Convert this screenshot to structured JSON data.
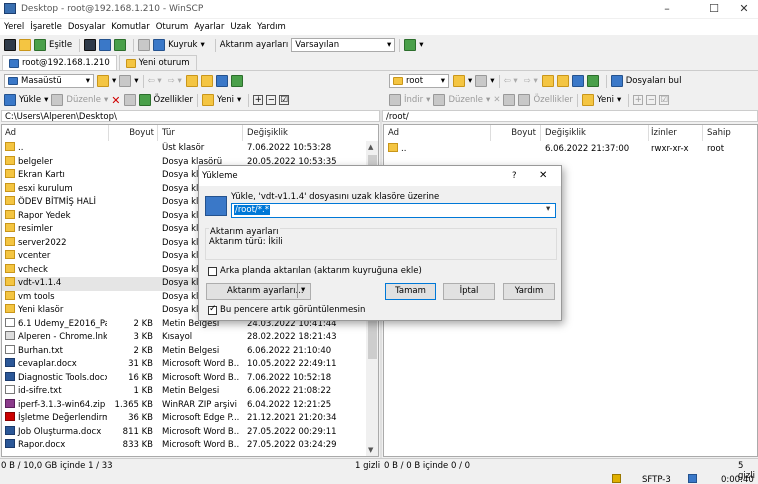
{
  "window": {
    "title": "Desktop - root@192.168.1.210 - WinSCP",
    "minimize": "–",
    "maximize": "☐",
    "close": "✕"
  },
  "menu": [
    "Yerel",
    "İşaretle",
    "Dosyalar",
    "Komutlar",
    "Oturum",
    "Ayarlar",
    "Uzak",
    "Yardım"
  ],
  "toolbar": {
    "sync_label": "Eşitle",
    "queue_label": "Kuyruk",
    "transfer_label": "Aktarım ayarları",
    "transfer_value": "Varsayılan"
  },
  "tabs": {
    "session": "root@192.168.1.210",
    "new_session": "Yeni oturum"
  },
  "left": {
    "location": "Masaüstü",
    "actions": {
      "upload": "Yükle",
      "edit": "Düzenle",
      "properties": "Özellikler",
      "new": "Yeni"
    },
    "path": "C:\\Users\\Alperen\\Desktop\\",
    "columns": {
      "name": "Ad",
      "size": "Boyut",
      "type": "Tür",
      "changed": "Değişiklik"
    },
    "rows": [
      {
        "icon": "up",
        "name": "..",
        "size": "",
        "type": "Üst klasör",
        "changed": "7.06.2022  10:53:28"
      },
      {
        "icon": "folder",
        "name": "belgeler",
        "size": "",
        "type": "Dosya klasörü",
        "changed": "20.05.2022  10:53:35"
      },
      {
        "icon": "folder",
        "name": "Ekran Kartı",
        "size": "",
        "type": "Dosya klas",
        "changed": ""
      },
      {
        "icon": "folder",
        "name": "esxi kurulum",
        "size": "",
        "type": "Dosya klas",
        "changed": ""
      },
      {
        "icon": "folder",
        "name": "ÖDEV BİTMİŞ HALİ",
        "size": "",
        "type": "Dosya klas",
        "changed": ""
      },
      {
        "icon": "folder",
        "name": "Rapor Yedek",
        "size": "",
        "type": "Dosya klas",
        "changed": ""
      },
      {
        "icon": "folder",
        "name": "resimler",
        "size": "",
        "type": "Dosya klas",
        "changed": ""
      },
      {
        "icon": "folder",
        "name": "server2022",
        "size": "",
        "type": "Dosya klas",
        "changed": ""
      },
      {
        "icon": "folder",
        "name": "vcenter",
        "size": "",
        "type": "Dosya klas",
        "changed": ""
      },
      {
        "icon": "folder",
        "name": "vcheck",
        "size": "",
        "type": "Dosya klas",
        "changed": ""
      },
      {
        "icon": "folder",
        "name": "vdt-v1.1.4",
        "size": "",
        "type": "Dosya klas",
        "changed": "",
        "selected": true
      },
      {
        "icon": "folder",
        "name": "vm tools",
        "size": "",
        "type": "Dosya klas",
        "changed": ""
      },
      {
        "icon": "folder",
        "name": "Yeni klasör",
        "size": "",
        "type": "Dosya klas",
        "changed": ""
      },
      {
        "icon": "doc",
        "name": "6.1 Udemy_E2016_Par...",
        "size": "2 KB",
        "type": "Metin Belgesi",
        "changed": "24.03.2022  10:41:44"
      },
      {
        "icon": "lnk",
        "name": "Alperen - Chrome.lnk",
        "size": "3 KB",
        "type": "Kısayol",
        "changed": "28.02.2022  18:21:43"
      },
      {
        "icon": "doc",
        "name": "Burhan.txt",
        "size": "2 KB",
        "type": "Metin Belgesi",
        "changed": "6.06.2022  21:10:40"
      },
      {
        "icon": "word",
        "name": "cevaplar.docx",
        "size": "31 KB",
        "type": "Microsoft Word B...",
        "changed": "10.05.2022  22:49:11"
      },
      {
        "icon": "word",
        "name": "Diagnostic Tools.docx",
        "size": "16 KB",
        "type": "Microsoft Word B...",
        "changed": "7.06.2022  10:52:18"
      },
      {
        "icon": "doc",
        "name": "id-sifre.txt",
        "size": "1 KB",
        "type": "Metin Belgesi",
        "changed": "6.06.2022  21:08:22"
      },
      {
        "icon": "zip",
        "name": "iperf-3.1.3-win64.zip",
        "size": "1.365 KB",
        "type": "WinRAR ZIP arşivi",
        "changed": "6.04.2022  12:21:25"
      },
      {
        "icon": "pdf",
        "name": "İşletme Değerlendirm...",
        "size": "36 KB",
        "type": "Microsoft Edge P...",
        "changed": "21.12.2021  21:20:34"
      },
      {
        "icon": "word",
        "name": "Job Oluşturma.docx",
        "size": "811 KB",
        "type": "Microsoft Word B...",
        "changed": "27.05.2022  00:29:11"
      },
      {
        "icon": "word",
        "name": "Rapor.docx",
        "size": "833 KB",
        "type": "Microsoft Word B...",
        "changed": "27.05.2022  03:24:29"
      }
    ],
    "status": "0 B / 10,0 GB içinde 1 / 33",
    "hidden": "1 gizli"
  },
  "right": {
    "location": "root",
    "find_label": "Dosyaları bul",
    "actions": {
      "download": "İndir",
      "edit": "Düzenle",
      "properties": "Özellikler",
      "new": "Yeni"
    },
    "path": "/root/",
    "columns": {
      "name": "Ad",
      "size": "Boyut",
      "changed": "Değişiklik",
      "rights": "İzinler",
      "owner": "Sahip"
    },
    "rows": [
      {
        "name": "..",
        "size": "",
        "changed": "6.06.2022 21:37:00",
        "rights": "rwxr-xr-x",
        "owner": "root"
      }
    ],
    "status": "0 B / 0 B içinde 0 / 0",
    "hidden": "5 gizli"
  },
  "statusbar": {
    "protocol": "SFTP-3",
    "time": "0:00:40"
  },
  "dialog": {
    "title": "Yükleme",
    "help": "?",
    "close": "✕",
    "prompt": "Yükle, 'vdt-v1.1.4' dosyasını uzak klasöre üzerine",
    "target": "/root/*.*",
    "group_title": "Aktarım ayarları",
    "group_text": "Aktarım türü: İkili",
    "background_label": "Arka planda aktarılan (aktarım kuyruğuna ekle)",
    "settings_btn": "Aktarım ayarları...",
    "ok": "Tamam",
    "cancel": "İptal",
    "help_btn": "Yardım",
    "dont_show": "Bu pencere artık görüntülenmesin"
  }
}
